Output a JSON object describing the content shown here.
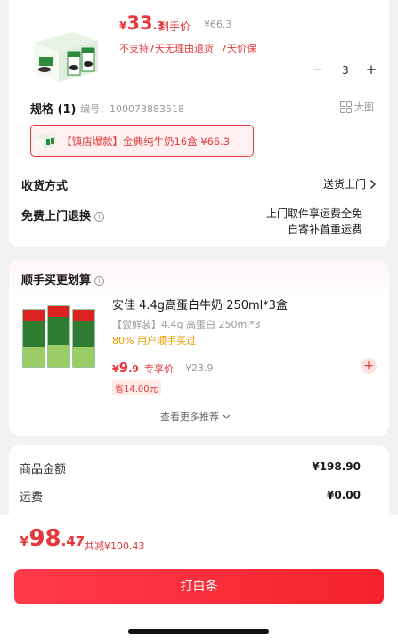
{
  "product": {
    "image_icon": "milk-carton-box-image",
    "price_currency": "¥",
    "price_int": "33",
    "price_dec": ".3",
    "to_hand_label": "到手价",
    "original_price": "¥66.3",
    "note_no_return": "不支持7天无理由退货",
    "note_price_protect": "7天价保",
    "quantity": "3",
    "minus_label": "−",
    "plus_label": "+"
  },
  "spec": {
    "label": "规格 (1)",
    "code": "编号：100073883518",
    "big_image_label": "大图",
    "chip_text": "【镇店爆款】金典纯牛奶16盒  ¥66.3"
  },
  "delivery": {
    "label": "收货方式",
    "value": "送货上门"
  },
  "free_return": {
    "label": "免费上门退换",
    "value_line1": "上门取件享运费全免",
    "value_line2": "自寄补首重运费"
  },
  "recommend": {
    "title": "顺手买更划算",
    "item_title": "安佳 4.4g高蛋白牛奶 250ml*3盒",
    "item_sub": "【尝鲜装】4.4g 高蛋白 250ml*3",
    "item_bought": "80% 用户顺手买过",
    "price_currency": "¥",
    "price_int": "9",
    "price_dec": ".9",
    "price_tag": "专享价",
    "original_price": "¥23.9",
    "save_label": "省14.00元",
    "add_label": "+",
    "more_label": "查看更多推荐"
  },
  "summary": {
    "goods_label": "商品金额",
    "goods_value": "¥198.90",
    "shipping_label": "运费",
    "shipping_value": "¥0.00"
  },
  "footer": {
    "currency": "¥",
    "total_int": "98",
    "total_dec": ".47",
    "discount": "共减¥100.43",
    "pay_button": "打白条"
  },
  "colors": {
    "accent": "#e4393c",
    "background": "#f2f2f2"
  }
}
